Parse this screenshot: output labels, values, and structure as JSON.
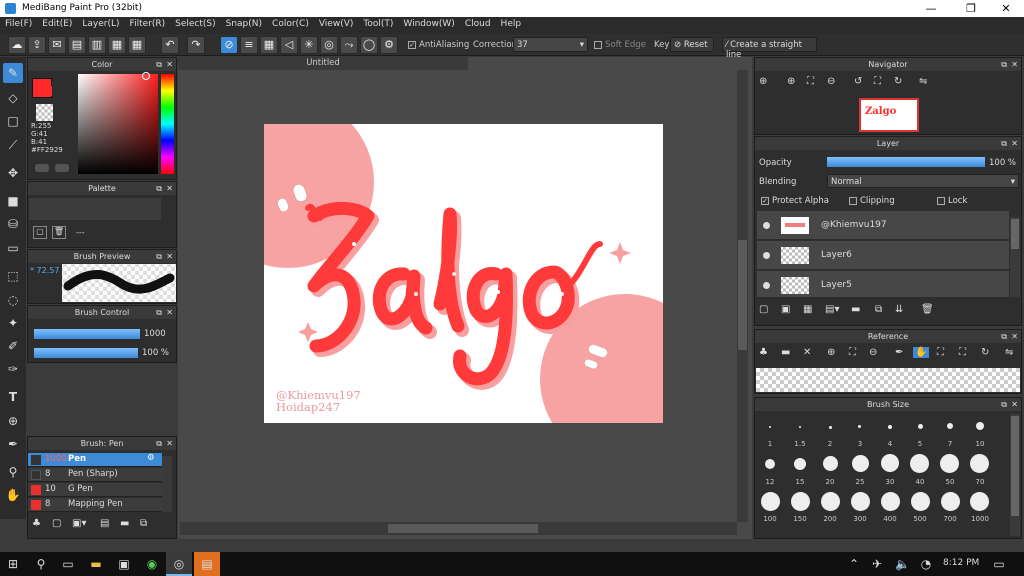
{
  "window": {
    "title": "MediBang Paint Pro (32bit)",
    "min": "—",
    "max": "❐",
    "close": "✕"
  },
  "menu": [
    "File(F)",
    "Edit(E)",
    "Layer(L)",
    "Filter(R)",
    "Select(S)",
    "Snap(N)",
    "Color(C)",
    "View(V)",
    "Tool(T)",
    "Window(W)",
    "Cloud",
    "Help"
  ],
  "toolbar": {
    "antialiasing": "AntiAliasing",
    "correction_label": "Correction",
    "correction_value": "37",
    "soft_edge": "Soft Edge",
    "key": "Key",
    "reset": "Reset",
    "straight_line": "Create a straight line"
  },
  "color_panel": {
    "title": "Color",
    "r": "R:255",
    "g": "G:41",
    "b": "B:41",
    "hex": "#FF2929",
    "fg_color": "#ff2929"
  },
  "palette_panel": {
    "title": "Palette",
    "dash": "---"
  },
  "brush_preview": {
    "title": "Brush Preview",
    "size": "* 72.57"
  },
  "brush_control": {
    "title": "Brush Control",
    "size_value": "1000",
    "opacity_value": "100 %"
  },
  "brush_list": {
    "title": "Brush: Pen",
    "items": [
      {
        "size": "1000",
        "name": "Pen",
        "color": "#333333",
        "selected": true
      },
      {
        "size": "8",
        "name": "Pen (Sharp)",
        "color": "#333333",
        "selected": false
      },
      {
        "size": "10",
        "name": "G Pen",
        "color": "#e83030",
        "selected": false
      },
      {
        "size": "8",
        "name": "Mapping Pen",
        "color": "#e83030",
        "selected": false
      }
    ]
  },
  "canvas": {
    "tab_title": "Untitled",
    "artwork_text": "Zalgo",
    "signature_line1": "@Khiemvu197",
    "signature_line2": "Hoidap247"
  },
  "navigator": {
    "title": "Navigator"
  },
  "layer_panel": {
    "title": "Layer",
    "opacity_label": "Opacity",
    "opacity_value": "100 %",
    "blending_label": "Blending",
    "blending_value": "Normal",
    "protect_alpha": "Protect Alpha",
    "clipping": "Clipping",
    "lock": "Lock",
    "layers": [
      "@Khiemvu197",
      "Layer6",
      "Layer5"
    ]
  },
  "reference_panel": {
    "title": "Reference"
  },
  "brush_size_panel": {
    "title": "Brush Size",
    "row1": [
      "1",
      "1.5",
      "2",
      "3",
      "4",
      "5",
      "7",
      "10"
    ],
    "row2": [
      "12",
      "15",
      "20",
      "25",
      "30",
      "40",
      "50",
      "70"
    ],
    "row3": [
      "100",
      "150",
      "200",
      "300",
      "400",
      "500",
      "700",
      "1000"
    ]
  },
  "taskbar": {
    "time": "8:12 PM"
  },
  "accent": "#3d8ad6"
}
